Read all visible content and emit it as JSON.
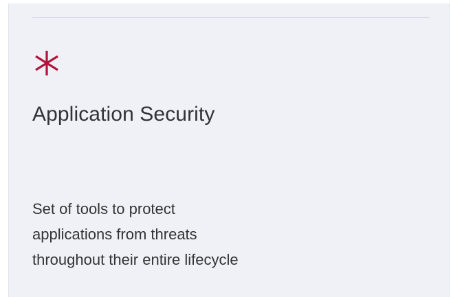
{
  "card": {
    "icon": "asterisk-icon",
    "title": "Application Security",
    "description_lines": [
      "Set of tools to protect",
      "applications from threats",
      "throughout their entire lifecycle"
    ]
  },
  "colors": {
    "accent": "#b0143a",
    "card_background": "#eff1f7",
    "text": "#2f3337"
  }
}
